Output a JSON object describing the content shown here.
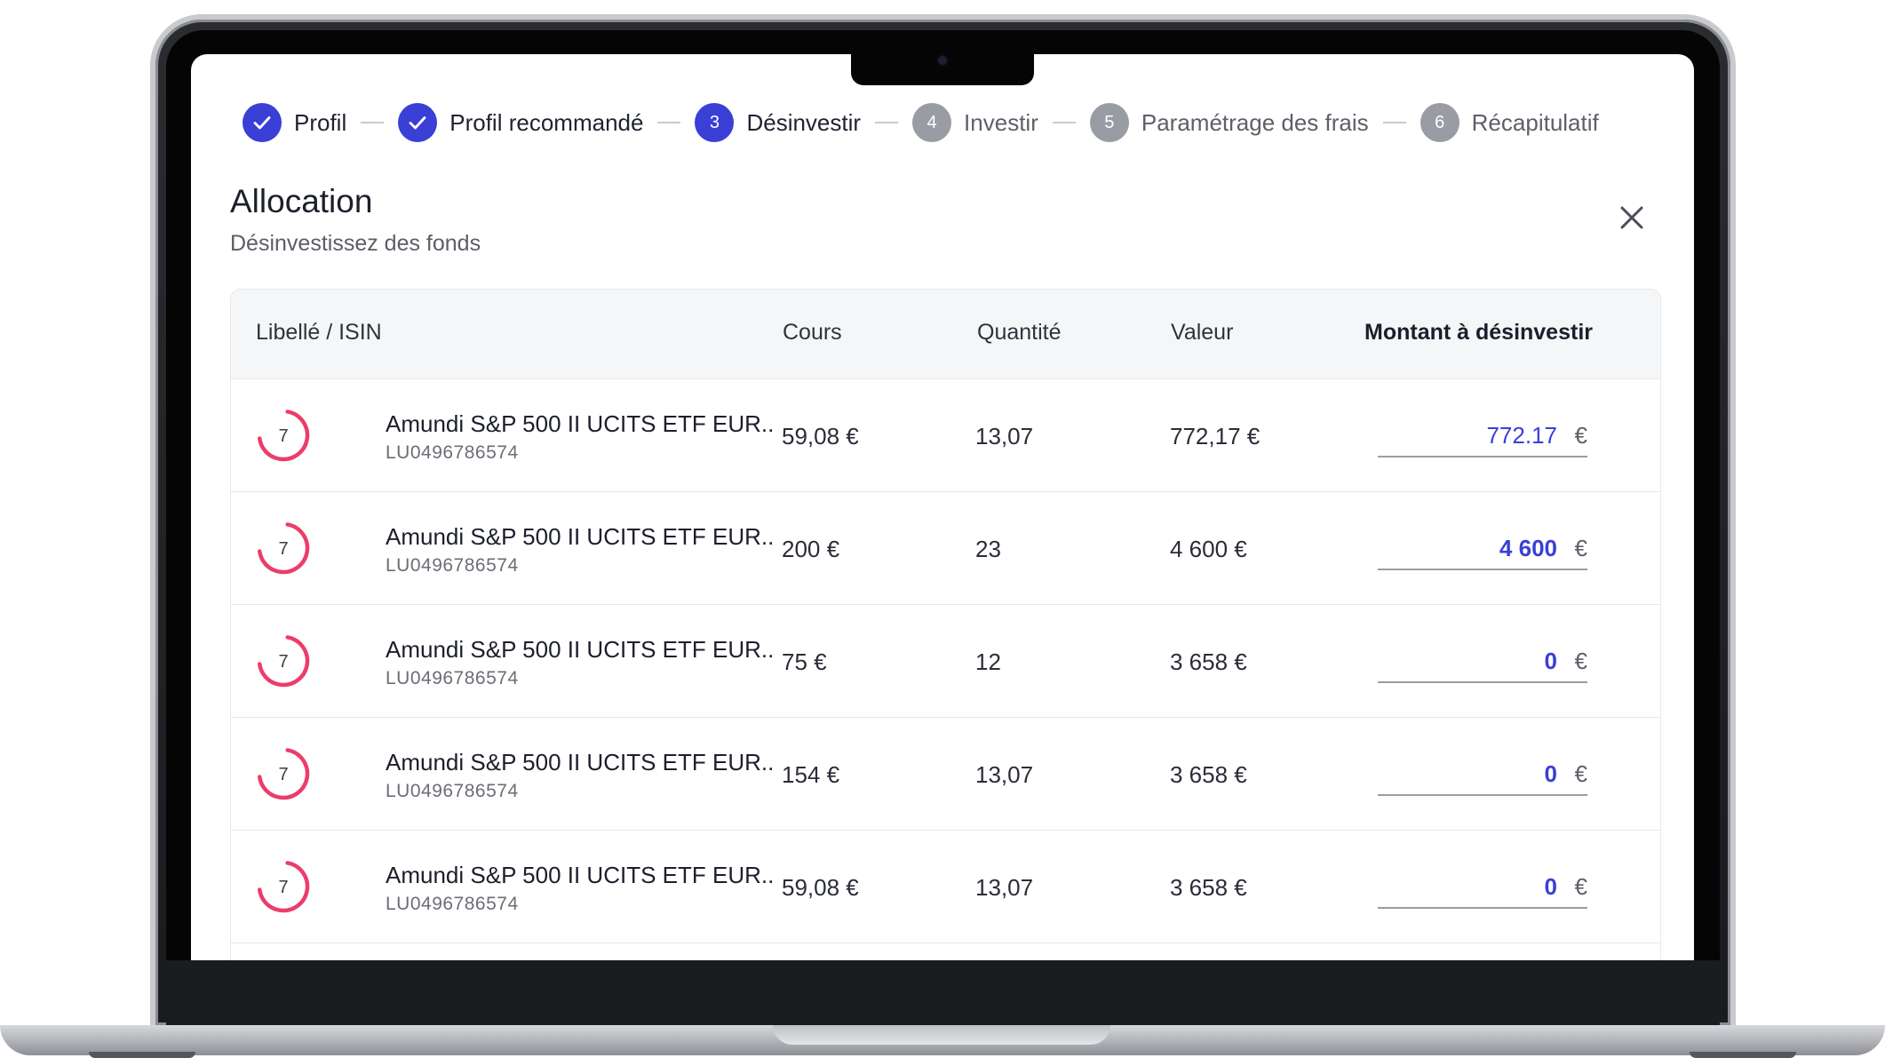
{
  "stepper": [
    {
      "state": "done",
      "number": "",
      "label": "Profil"
    },
    {
      "state": "done",
      "number": "",
      "label": "Profil recommandé"
    },
    {
      "state": "current",
      "number": "3",
      "label": "Désinvestir"
    },
    {
      "state": "todo",
      "number": "4",
      "label": "Investir"
    },
    {
      "state": "todo",
      "number": "5",
      "label": "Paramétrage des frais"
    },
    {
      "state": "todo",
      "number": "6",
      "label": "Récapitulatif"
    }
  ],
  "header": {
    "title": "Allocation",
    "subtitle": "Désinvestissez des fonds"
  },
  "table": {
    "columns": {
      "label": "Libellé / ISIN",
      "price": "Cours",
      "quantity": "Quantité",
      "value": "Valeur",
      "amount": "Montant à désinvestir"
    },
    "rows": [
      {
        "risk": "7",
        "risk_fraction": 0.7,
        "name": "Amundi S&P 500 II UCITS ETF EUR..",
        "isin": "LU0496786574",
        "price": "59,08 €",
        "quantity": "13,07",
        "value": "772,17 €",
        "amount": "772.17",
        "currency": "€"
      },
      {
        "risk": "7",
        "risk_fraction": 0.7,
        "name": "Amundi S&P 500 II UCITS ETF EUR..",
        "isin": "LU0496786574",
        "price": "200 €",
        "quantity": "23",
        "value": "4 600 €",
        "amount": "4 600",
        "currency": "€"
      },
      {
        "risk": "7",
        "risk_fraction": 0.7,
        "name": "Amundi S&P 500 II UCITS ETF EUR..",
        "isin": "LU0496786574",
        "price": "75 €",
        "quantity": "12",
        "value": "3 658 €",
        "amount": "0",
        "currency": "€"
      },
      {
        "risk": "7",
        "risk_fraction": 0.7,
        "name": "Amundi S&P 500 II UCITS ETF EUR..",
        "isin": "LU0496786574",
        "price": "154 €",
        "quantity": "13,07",
        "value": "3 658 €",
        "amount": "0",
        "currency": "€"
      },
      {
        "risk": "7",
        "risk_fraction": 0.7,
        "name": "Amundi S&P 500 II UCITS ETF EUR..",
        "isin": "LU0496786574",
        "price": "59,08 €",
        "quantity": "13,07",
        "value": "3 658 €",
        "amount": "0",
        "currency": "€"
      }
    ]
  },
  "colors": {
    "accent": "#3a3fd6",
    "risk": "#ec3d6a",
    "todo_step": "#9a9ca3"
  },
  "icons": {
    "done_step": "check-icon",
    "close": "close-icon",
    "risk_indicator": "risk-gauge-icon"
  }
}
